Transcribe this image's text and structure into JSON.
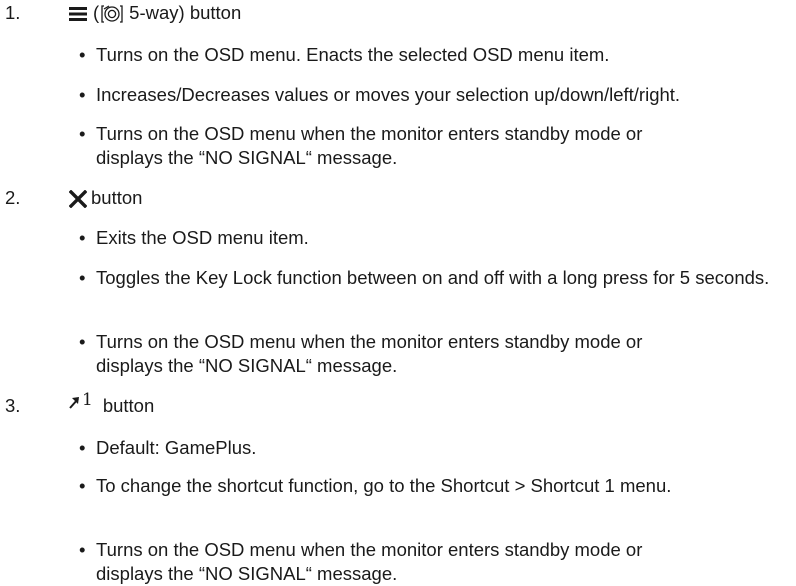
{
  "items": [
    {
      "number": "1.",
      "head_open": "(",
      "head_text": "5-way) button",
      "bullets": [
        "Turns on the OSD menu. Enacts the selected OSD menu item.",
        "Increases/Decreases values or moves your selection up/down/left/right.",
        "Turns on the OSD menu when the monitor enters standby mode or displays the “NO SIGNAL“ message."
      ]
    },
    {
      "number": "2.",
      "head_text": "button",
      "bullets": [
        "Exits the OSD menu item.",
        "Toggles the Key Lock function between on and off with a long press for 5 seconds.",
        "Turns on the OSD menu when the monitor enters standby mode or displays the “NO SIGNAL“ message."
      ]
    },
    {
      "number": "3.",
      "shortcut_digit": "1",
      "head_text": "button",
      "bullets": [
        "Default: GamePlus.",
        "To change the shortcut function, go to the Shortcut > Shortcut 1 menu.",
        "Turns on the OSD menu when the monitor enters standby mode or displays the “NO SIGNAL“ message."
      ]
    }
  ],
  "icons": {
    "item1_primary": "menu-lines-icon",
    "item1_secondary": "five-way-joystick-icon",
    "item2": "close-x-icon",
    "item3": "shortcut-arrow-icon"
  }
}
